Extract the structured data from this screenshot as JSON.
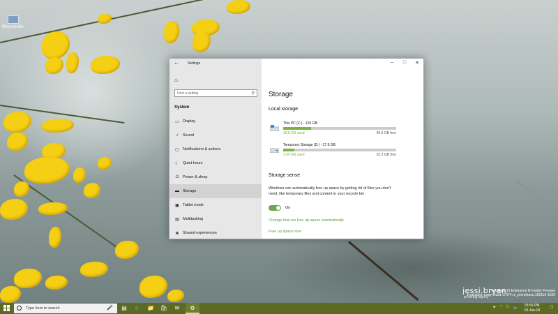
{
  "window": {
    "title": "Settings",
    "back_icon": "arrow-left-icon",
    "minimize": "–",
    "maximize": "□",
    "close": "✕"
  },
  "sidebar": {
    "home_icon": "⌂",
    "search_placeholder": "Find a setting",
    "section": "System",
    "items": [
      {
        "label": "Display",
        "icon": "▭"
      },
      {
        "label": "Sound",
        "icon": "♪"
      },
      {
        "label": "Notifications & actions",
        "icon": "▢"
      },
      {
        "label": "Quiet hours",
        "icon": "☾"
      },
      {
        "label": "Power & sleep",
        "icon": "⏻"
      },
      {
        "label": "Storage",
        "icon": "▬"
      },
      {
        "label": "Tablet mode",
        "icon": "▣"
      },
      {
        "label": "Multitasking",
        "icon": "▤"
      },
      {
        "label": "Shared experiences",
        "icon": "❀"
      }
    ],
    "active_index": 5
  },
  "main": {
    "title": "Storage",
    "local_storage_heading": "Local storage",
    "drives": [
      {
        "name": "This PC (C:) - 126 GB",
        "used": "30.8 GB used",
        "free": "95.6 GB free",
        "used_fraction": 0.244
      },
      {
        "name": "Temporary Storage (D:) - 27.9 GB",
        "used": "2.69 GB used",
        "free": "25.2 GB free",
        "used_fraction": 0.096
      }
    ],
    "storage_sense_heading": "Storage sense",
    "storage_sense_desc": "Windows can automatically free up space by getting rid of files you don't need, like temporary files and content in your recycle bin",
    "toggle_state": "On",
    "link_change": "Change how we free up space automatically",
    "link_free": "Free up space now"
  },
  "taskbar": {
    "search_placeholder": "Type here to search",
    "time": "05:56 PM",
    "date": "19-Jan-18"
  },
  "desktop": {
    "icon_label": "Recycle Bin",
    "watermark": "jessi.bryan",
    "watermark_sub": "photography",
    "eval_line1": "Windows 10 Enterprise N Insider Preview",
    "eval_line2": "Evaluation copy. Build 17074.rs_prerelease.180116-1539"
  },
  "colors": {
    "accent": "#7cb342",
    "taskbar": "#5d6a24",
    "link": "#5c9d3a"
  }
}
